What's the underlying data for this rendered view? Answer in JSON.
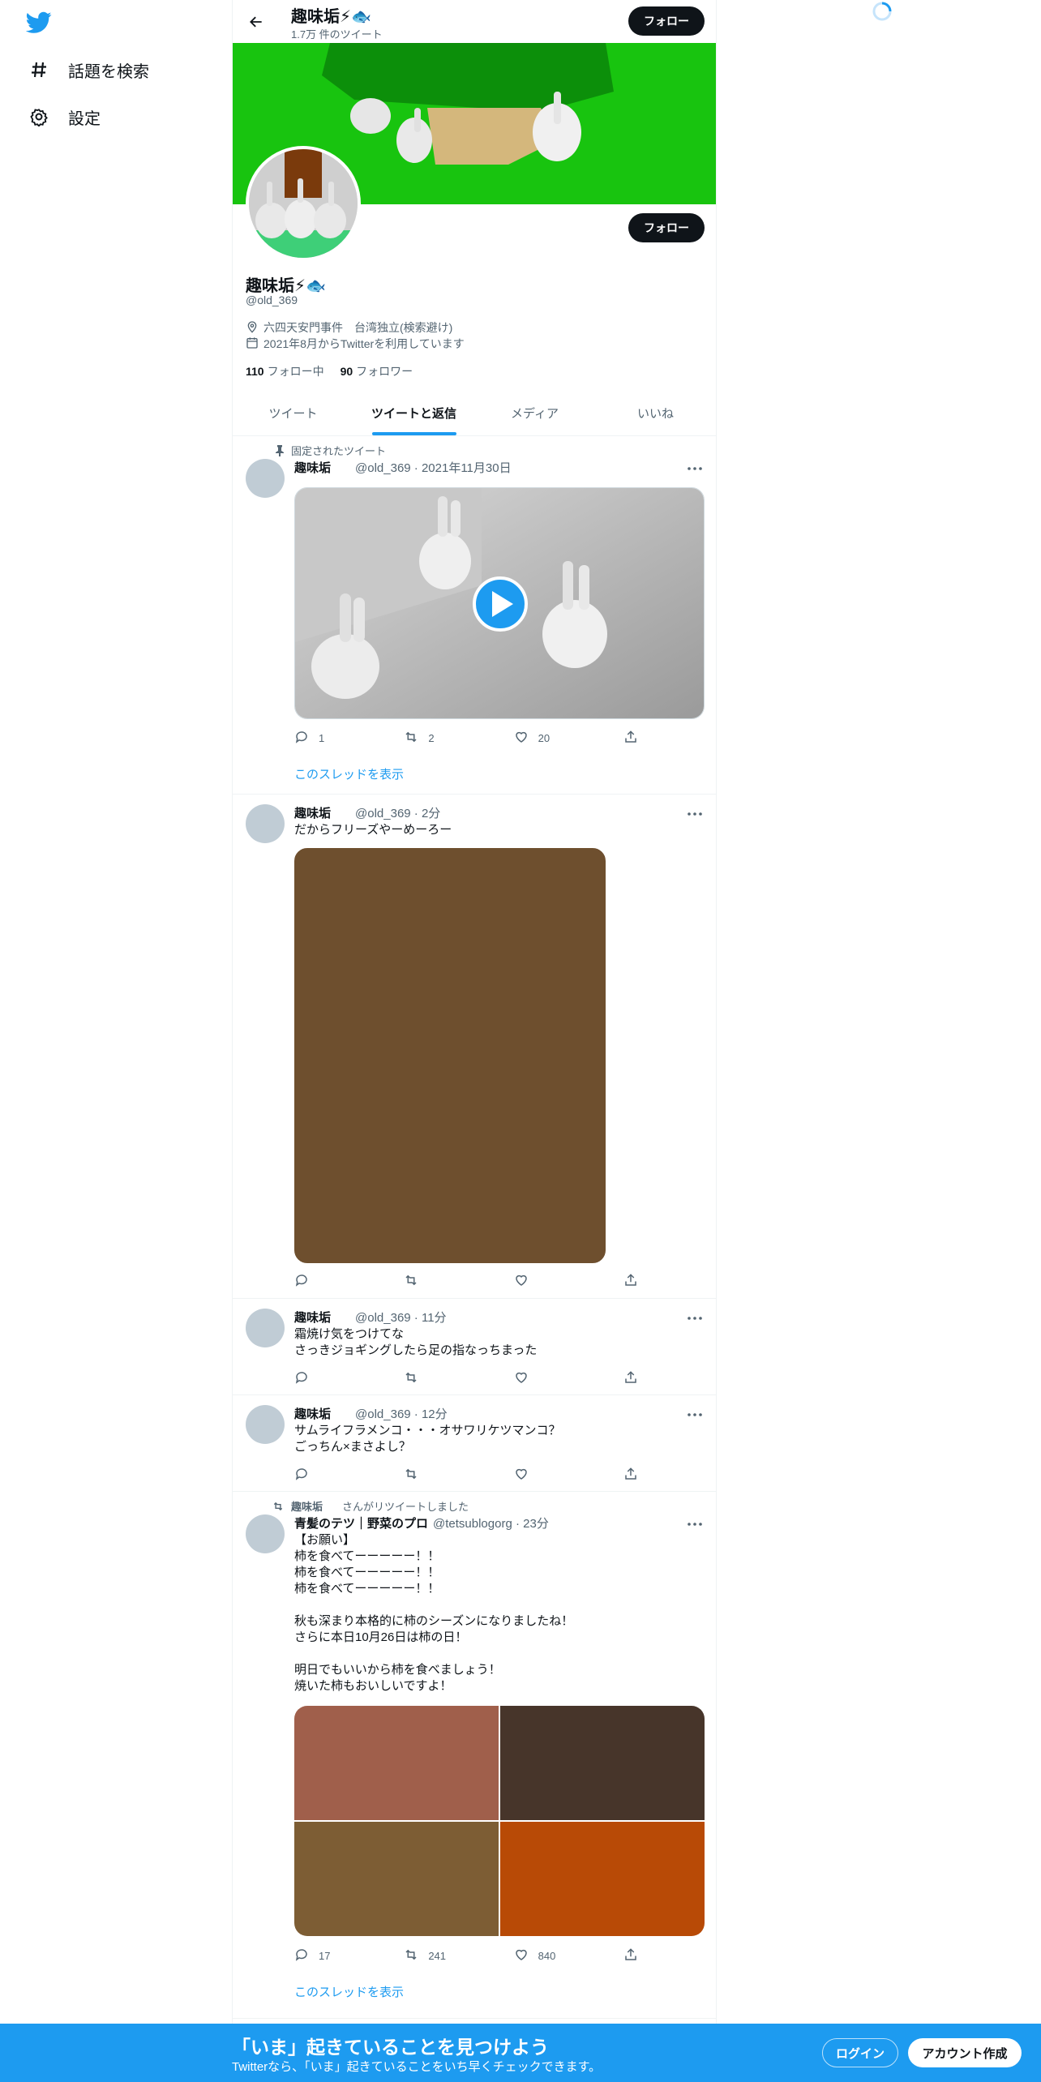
{
  "nav": {
    "items": [
      {
        "label": "話題を検索",
        "icon": "hashtag-icon"
      },
      {
        "label": "設定",
        "icon": "gear-icon"
      }
    ]
  },
  "header": {
    "name": "趣味垢⚡🐟",
    "tweet_count": "1.7万 件のツイート",
    "follow_label": "フォロー"
  },
  "profile": {
    "name": "趣味垢⚡🐟",
    "handle": "@old_369",
    "location": "六四天安門事件　台湾独立(検索避け)",
    "joined": "2021年8月からTwitterを利用しています",
    "following_count": "110",
    "following_label": "フォロー中",
    "followers_count": "90",
    "followers_label": "フォロワー",
    "follow_label": "フォロー"
  },
  "tabs": [
    "ツイート",
    "ツイートと返信",
    "メディア",
    "いいね"
  ],
  "tweets": [
    {
      "context": "固定されたツイート",
      "name": "趣味垢",
      "meta": "@old_369 · 2021年11月30日",
      "reply": "1",
      "retweet": "2",
      "like": "20",
      "thread_link": "このスレッドを表示"
    },
    {
      "name": "趣味垢",
      "meta": "@old_369 · 2分",
      "text": "だからフリーズやーめーろー"
    },
    {
      "name": "趣味垢",
      "meta": "@old_369 · 11分",
      "text": "霜焼け気をつけてな\nさっきジョギングしたら足の指なっちまった"
    },
    {
      "name": "趣味垢",
      "meta": "@old_369 · 12分",
      "text": "サムライフラメンコ・・・オサワリケツマンコ？\nごっちん×まさよし？"
    },
    {
      "context_name": "趣味垢",
      "context": "さんがリツイートしました",
      "name": "青髪のテツ｜野菜のプロ",
      "meta": "@tetsublogorg · 23分",
      "text": "【お願い】\n柿を食べてーーーーー！！\n柿を食べてーーーーー！！\n柿を食べてーーーーー！！\n\n秋も深まり本格的に柿のシーズンになりましたね！\nさらに本日10月26日は柿の日！\n\n明日でもいいから柿を食べましょう！\n焼いた柿もおいしいですよ！",
      "reply": "17",
      "retweet": "241",
      "like": "840",
      "thread_link": "このスレッドを表示",
      "image_colors": [
        "#a05f4b",
        "#47352a",
        "#7d5d34",
        "#b84a06"
      ]
    }
  ],
  "media_colors": {
    "brown": "#6e4f2e",
    "banner_green": "#18c40f",
    "accent": "#1d9bf0"
  },
  "bottom": {
    "title": "「いま」起きていることを見つけよう",
    "subtitle": "Twitterなら、「いま」起きていることをいち早くチェックできます。",
    "login": "ログイン",
    "signup": "アカウント作成"
  }
}
